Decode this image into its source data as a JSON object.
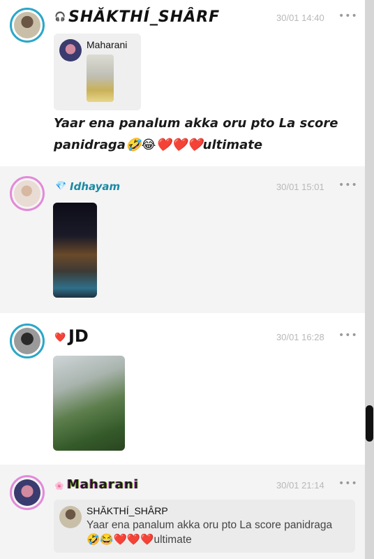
{
  "posts": [
    {
      "username": "SHĂKTHÍ_SHÂRF",
      "badge": "🎧",
      "timestamp": "30/01 14:40",
      "more": "•••",
      "shared": {
        "author": "Maharani"
      },
      "caption": "Yaar ena panalum akka oru pto La score panidraga🤣😂❤️❤️❤️ultimate"
    },
    {
      "username": "Idhayam",
      "badge": "💎",
      "timestamp": "30/01 15:01",
      "more": "•••"
    },
    {
      "username": "JD",
      "badge": "❤️",
      "timestamp": "30/01 16:28",
      "more": "•••"
    },
    {
      "username": "Maharani",
      "badge": "🌸",
      "timestamp": "30/01 21:14",
      "more": "•••",
      "reply": {
        "author": "SHĂKTHÍ_SHÂRP",
        "text": "Yaar ena panalum akka oru pto La score panidraga🤣😂❤️❤️❤️ultimate"
      }
    }
  ],
  "colors": {
    "ring_blue": "#2aa7c9",
    "ring_pink": "#e28ad9",
    "timestamp": "#b8b8b8",
    "idhayam_name": "#1a8aa5",
    "grey_bg": "#f4f4f4"
  }
}
